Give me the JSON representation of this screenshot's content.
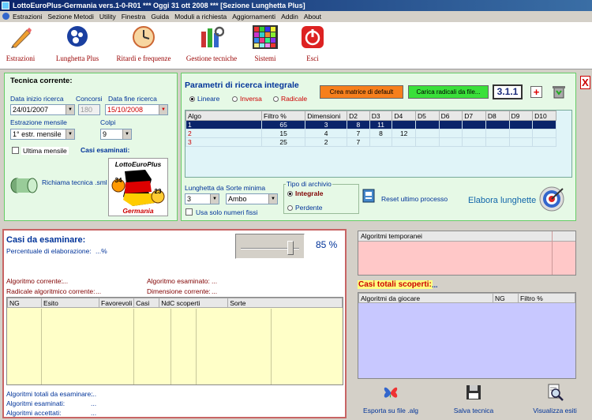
{
  "window": {
    "title": "LottoEuroPlus-Germania vers.1-0-R01  ***  Oggi 31 ott 2008  ***  [Sezione Lunghetta Plus]"
  },
  "menu": [
    "Estrazioni",
    "Sezione Metodi",
    "Utility",
    "Finestra",
    "Guida",
    "Moduli a richiesta",
    "Aggiornamenti",
    "Addin",
    "About"
  ],
  "toolbar": {
    "b1": "Estrazioni",
    "b2": "Lunghetta Plus",
    "b3": "Ritardi e frequenze",
    "b4": "Gestione tecniche",
    "b5": "Sistemi",
    "b6": "Esci"
  },
  "tecnica": {
    "title": "Tecnica corrente:",
    "data_inizio_label": "Data inizio ricerca",
    "data_inizio": "24/01/2007",
    "concorsi_label": "Concorsi",
    "concorsi": "180",
    "data_fine_label": "Data fine ricerca",
    "data_fine": "15/10/2008",
    "estrazione_label": "Estrazione mensile",
    "estrazione": "1° estr. mensile",
    "colpi_label": "Colpi",
    "colpi": "9",
    "ultima_mensile": "Ultima mensile",
    "casi_esaminati": "Casi esaminati:",
    "richiama": "Richiama tecnica .sml",
    "logo_title": "LottoEuroPlus",
    "logo_sub": "Germania",
    "ball1": "34",
    "ball2": "23"
  },
  "parametri": {
    "title": "Parametri di ricerca integrale",
    "radio_lineare": "Lineare",
    "radio_inversa": "Inversa",
    "radio_radicale": "Radicale",
    "btn_crea": "Crea matrice di default",
    "btn_carica": "Carica radicali da file...",
    "version": "3.1.1",
    "plus": "+",
    "columns": [
      "Algo",
      "Filtro %",
      "Dimensioni",
      "D2",
      "D3",
      "D4",
      "D5",
      "D6",
      "D7",
      "D8",
      "D9",
      "D10"
    ],
    "rows": [
      [
        "1",
        "65",
        "3",
        "8",
        "11",
        "",
        "",
        "",
        "",
        "",
        "",
        ""
      ],
      [
        "2",
        "15",
        "4",
        "7",
        "8",
        "12",
        "",
        "",
        "",
        "",
        "",
        ""
      ],
      [
        "3",
        "25",
        "2",
        "7",
        "",
        "",
        "",
        "",
        "",
        "",
        "",
        ""
      ]
    ],
    "lunghetta_label": "Lunghetta da",
    "lunghetta": "3",
    "sorte_label": "Sorte minima",
    "sorte": "Ambo",
    "usa_fissi": "Usa solo numeri fissi",
    "archivio_label": "Tipo di archivio",
    "integrale": "Integrale",
    "perdente": "Perdente",
    "reset": "Reset ultimo processo",
    "elabora": "Elabora lunghette"
  },
  "close_x": "X",
  "casi": {
    "title": "Casi da esaminare:",
    "perc_label": "Percentuale di elaborazione:",
    "perc_value": "...%",
    "percent": "85 %",
    "slider_fraction": 0.85,
    "algo_corrente_label": "Algoritmo corrente:",
    "algo_corrente": "...",
    "radicale_label": "Radicale algoritmico corrente:",
    "radicale": "...",
    "algo_esaminato_label": "Algoritmo esaminato:",
    "algo_esaminato": "...",
    "dimensione_label": "Dimensione corrente:",
    "dimensione": "...",
    "columns": [
      "NG",
      "Esito",
      "Favorevoli",
      "Casi",
      "NdC scoperti",
      "Sorte"
    ],
    "tot_label": "Algoritmi totali da esaminare:",
    "tot": "...",
    "esam_label": "Algoritmi esaminati:",
    "esam": "...",
    "acc_label": "Algoritmi accettati:",
    "acc": "..."
  },
  "right": {
    "temporanei": "Algoritmi temporanei",
    "scoperti_label": "Casi totali scoperti:",
    "scoperti": "...",
    "columns": [
      "Algoritmi da giocare",
      "NG",
      "Filtro %"
    ],
    "esporta": "Esporta su file .alg",
    "salva": "Salva tecnica",
    "visualizza": "Visualizza esiti"
  }
}
